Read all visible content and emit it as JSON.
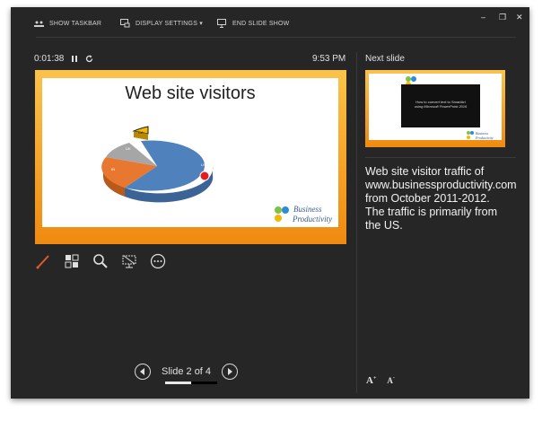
{
  "toolbar": {
    "show_taskbar": "SHOW TASKBAR",
    "display_settings": "DISPLAY SETTINGS ▾",
    "end_slide_show": "END SLIDE SHOW"
  },
  "window_controls": {
    "minimize": "–",
    "restore": "❐",
    "close": "✕"
  },
  "timer": {
    "elapsed": "0:01:38",
    "pause_icon": "pause-icon",
    "reset_icon": "reset-icon"
  },
  "clock": "9:53 PM",
  "current_slide": {
    "title": "Web site visitors",
    "chart_data": {
      "type": "pie",
      "values": [
        62,
        22,
        10,
        6
      ],
      "labels": [
        "Other 58%",
        "",
        "",
        "6%"
      ]
    },
    "pie_labels": {
      "a": "US",
      "b": "IN",
      "c": "UK",
      "d": "CA"
    },
    "logo": {
      "line1": "Business",
      "line2": "Productivity"
    }
  },
  "tools": [
    "pen-icon",
    "see-all-slides-icon",
    "zoom-icon",
    "screen-icon",
    "more-options-icon"
  ],
  "navigation": {
    "label": "Slide 2 of 4",
    "progress_fraction": 0.5
  },
  "next_slide": {
    "label": "Next slide",
    "text_line1": "How to convert text to SmartArt",
    "text_line2": "using Microsoft PowerPoint 2016",
    "logo_line1": "Business",
    "logo_line2": "Productivity"
  },
  "notes": "Web site visitor traffic of www.businessproductivity.com from October 2011-2012. The traffic is primarily from the US.",
  "font_buttons": {
    "increase": "A",
    "decrease": "A"
  },
  "colors": {
    "background": "#262626",
    "accent": "#f6a327",
    "pie_blue": "#4f81bd",
    "pie_orange": "#e8782f",
    "pie_gray": "#a6a6a6",
    "pie_gold": "#f5b800"
  }
}
